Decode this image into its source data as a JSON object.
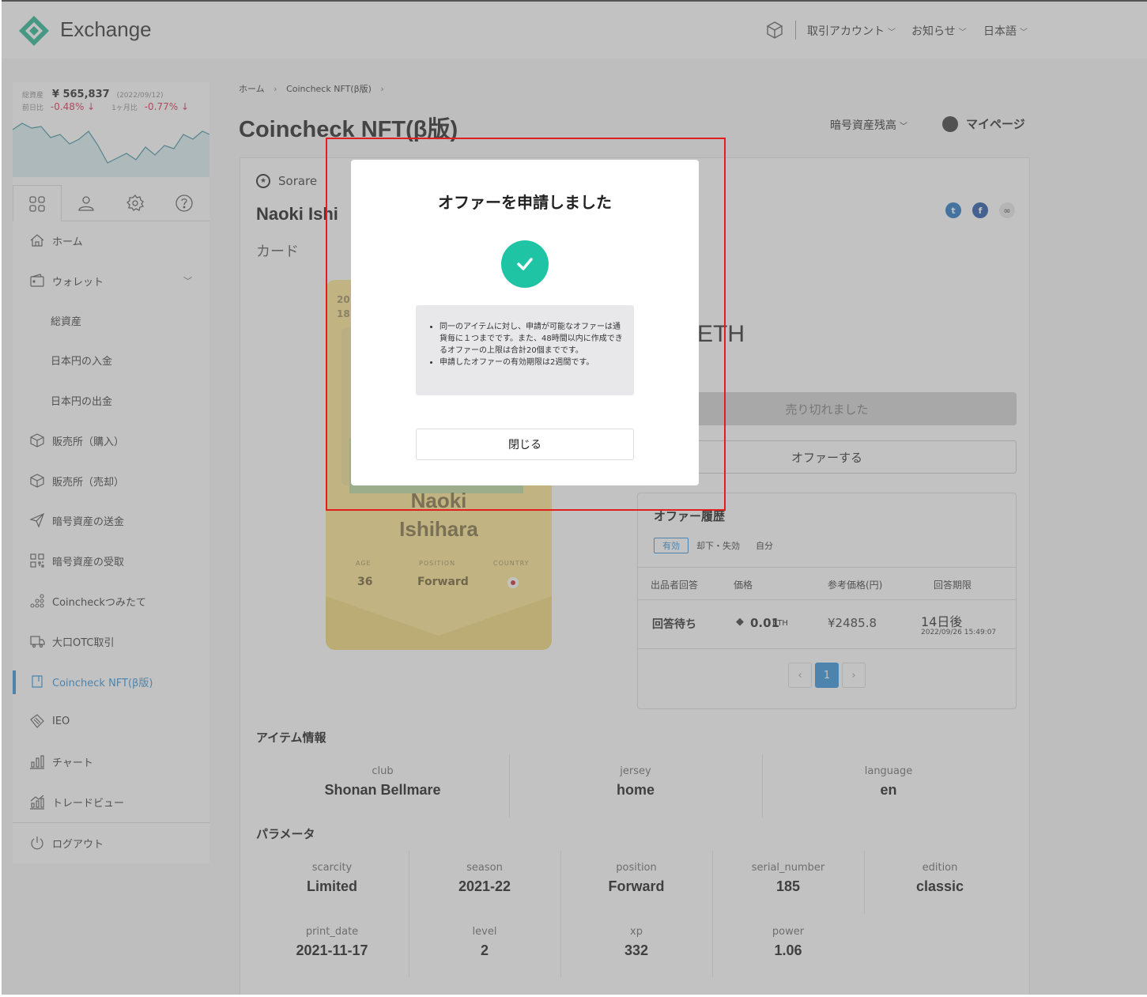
{
  "header": {
    "app_name": "Exchange",
    "icon": "cube-icon",
    "menu": [
      {
        "label": "取引アカウント"
      },
      {
        "label": "お知らせ"
      },
      {
        "label": "日本語"
      }
    ]
  },
  "sidebar": {
    "total_assets_label": "総資産",
    "total_assets_value": "¥ 565,837",
    "total_assets_date": "(2022/09/12)",
    "prev_day_label": "前日比",
    "prev_day_value": "-0.48% ↓",
    "month_label": "1ヶ月比",
    "month_value": "-0.77% ↓",
    "tab_icons": [
      "grid-icon",
      "user-icon",
      "gear-icon",
      "help-icon"
    ],
    "items": [
      {
        "label": "ホーム",
        "icon": "home-icon"
      },
      {
        "label": "ウォレット",
        "icon": "wallet-icon"
      },
      {
        "label": "総資産"
      },
      {
        "label": "日本円の入金"
      },
      {
        "label": "日本円の出金"
      },
      {
        "label": "販売所（購入）",
        "icon": "box-icon"
      },
      {
        "label": "販売所（売却）",
        "icon": "box-icon"
      },
      {
        "label": "暗号資産の送金",
        "icon": "send-icon"
      },
      {
        "label": "暗号資産の受取",
        "icon": "qr-icon"
      },
      {
        "label": "Coincheckつみたて",
        "icon": "coins-icon"
      },
      {
        "label": "大口OTC取引",
        "icon": "truck-icon"
      },
      {
        "label": "Coincheck NFT(β版)",
        "icon": "nft-icon"
      },
      {
        "label": "IEO",
        "icon": "ticket-icon"
      },
      {
        "label": "チャート",
        "icon": "chart-icon"
      },
      {
        "label": "トレードビュー",
        "icon": "tradeview-icon"
      },
      {
        "label": "ログアウト",
        "icon": "power-icon"
      }
    ]
  },
  "main": {
    "breadcrumb": [
      "ホーム",
      "Coincheck NFT(β版)"
    ],
    "title": "Coincheck NFT(β版)",
    "balance_dropdown": "暗号資産残高",
    "mypage": "マイページ",
    "collection": "Sorare",
    "item_name": "Naoki Ishihara",
    "item_name_visible": "Naoki Ishi",
    "category": "カード",
    "price_partial": "ETH",
    "soldout": "売り切れました",
    "offer_button": "オファーする",
    "nft_card": {
      "year_partial": "20",
      "serial_partial": "18",
      "first_name": "Naoki",
      "last_name": "Ishihara",
      "age_label": "AGE",
      "age": "36",
      "position_label": "POSITION",
      "position": "Forward",
      "country_label": "COUNTRY"
    },
    "offer_history": {
      "title": "オファー履歴",
      "filters": [
        "有効",
        "却下・失効",
        "自分"
      ],
      "columns": [
        "出品者回答",
        "価格",
        "参考価格(円)",
        "回答期限"
      ],
      "rows": [
        {
          "status": "回答待ち",
          "price": "0.01",
          "unit": "ETH",
          "ref_price": "¥2485.8",
          "deadline": "14日後",
          "deadline_date": "2022/09/26 15:49:07"
        }
      ],
      "page": "1"
    },
    "item_info_title": "アイテム情報",
    "item_info": [
      {
        "key": "club",
        "value": "Shonan Bellmare"
      },
      {
        "key": "jersey",
        "value": "home"
      },
      {
        "key": "language",
        "value": "en"
      }
    ],
    "params_title": "パラメータ",
    "params": [
      {
        "key": "scarcity",
        "value": "Limited"
      },
      {
        "key": "season",
        "value": "2021-22"
      },
      {
        "key": "position",
        "value": "Forward"
      },
      {
        "key": "serial_number",
        "value": "185"
      },
      {
        "key": "edition",
        "value": "classic"
      },
      {
        "key": "print_date",
        "value": "2021-11-17"
      },
      {
        "key": "level",
        "value": "2"
      },
      {
        "key": "xp",
        "value": "332"
      },
      {
        "key": "power",
        "value": "1.06"
      }
    ]
  },
  "modal": {
    "title": "オファーを申請しました",
    "notes": [
      "同一のアイテムに対し、申請が可能なオファーは通貨毎に１つまでです。また、48時間以内に作成できるオファーの上限は合計20個までです。",
      "申請したオファーの有効期限は2週間です。"
    ],
    "close_label": "閉じる"
  },
  "colors": {
    "accent": "#2a8fd9",
    "success": "#1fc4a4",
    "negative": "#d12b4a",
    "highlight": "#e0201f"
  }
}
